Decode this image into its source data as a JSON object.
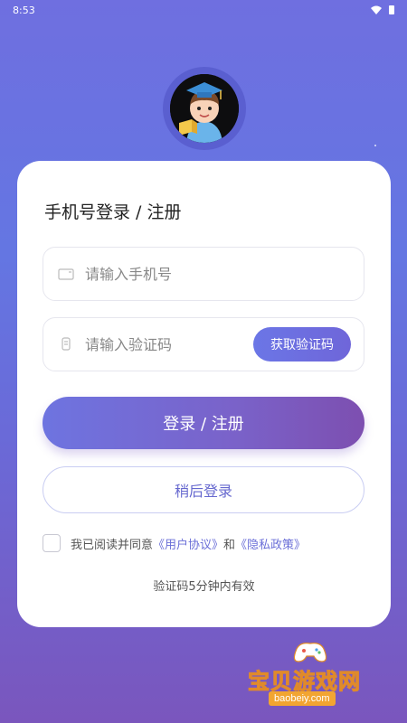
{
  "status_bar": {
    "time": "8:53"
  },
  "login": {
    "title": "手机号登录 / 注册",
    "phone_placeholder": "请输入手机号",
    "code_placeholder": "请输入验证码",
    "get_code_label": "获取验证码",
    "login_button_label": "登录 / 注册",
    "later_button_label": "稍后登录",
    "agreement": {
      "prefix": "我已阅读并同意",
      "user_agreement": "《用户协议》",
      "conjunction": "和",
      "privacy_policy": "《隐私政策》"
    },
    "code_valid_note": "验证码5分钟内有效"
  },
  "watermark": {
    "title": "宝贝游戏网",
    "url": "baobeiy.com"
  },
  "colors": {
    "accent": "#6b6fd8",
    "background_top": "#6f6fe0",
    "background_bottom": "#7a56bd",
    "card": "#ffffff"
  }
}
